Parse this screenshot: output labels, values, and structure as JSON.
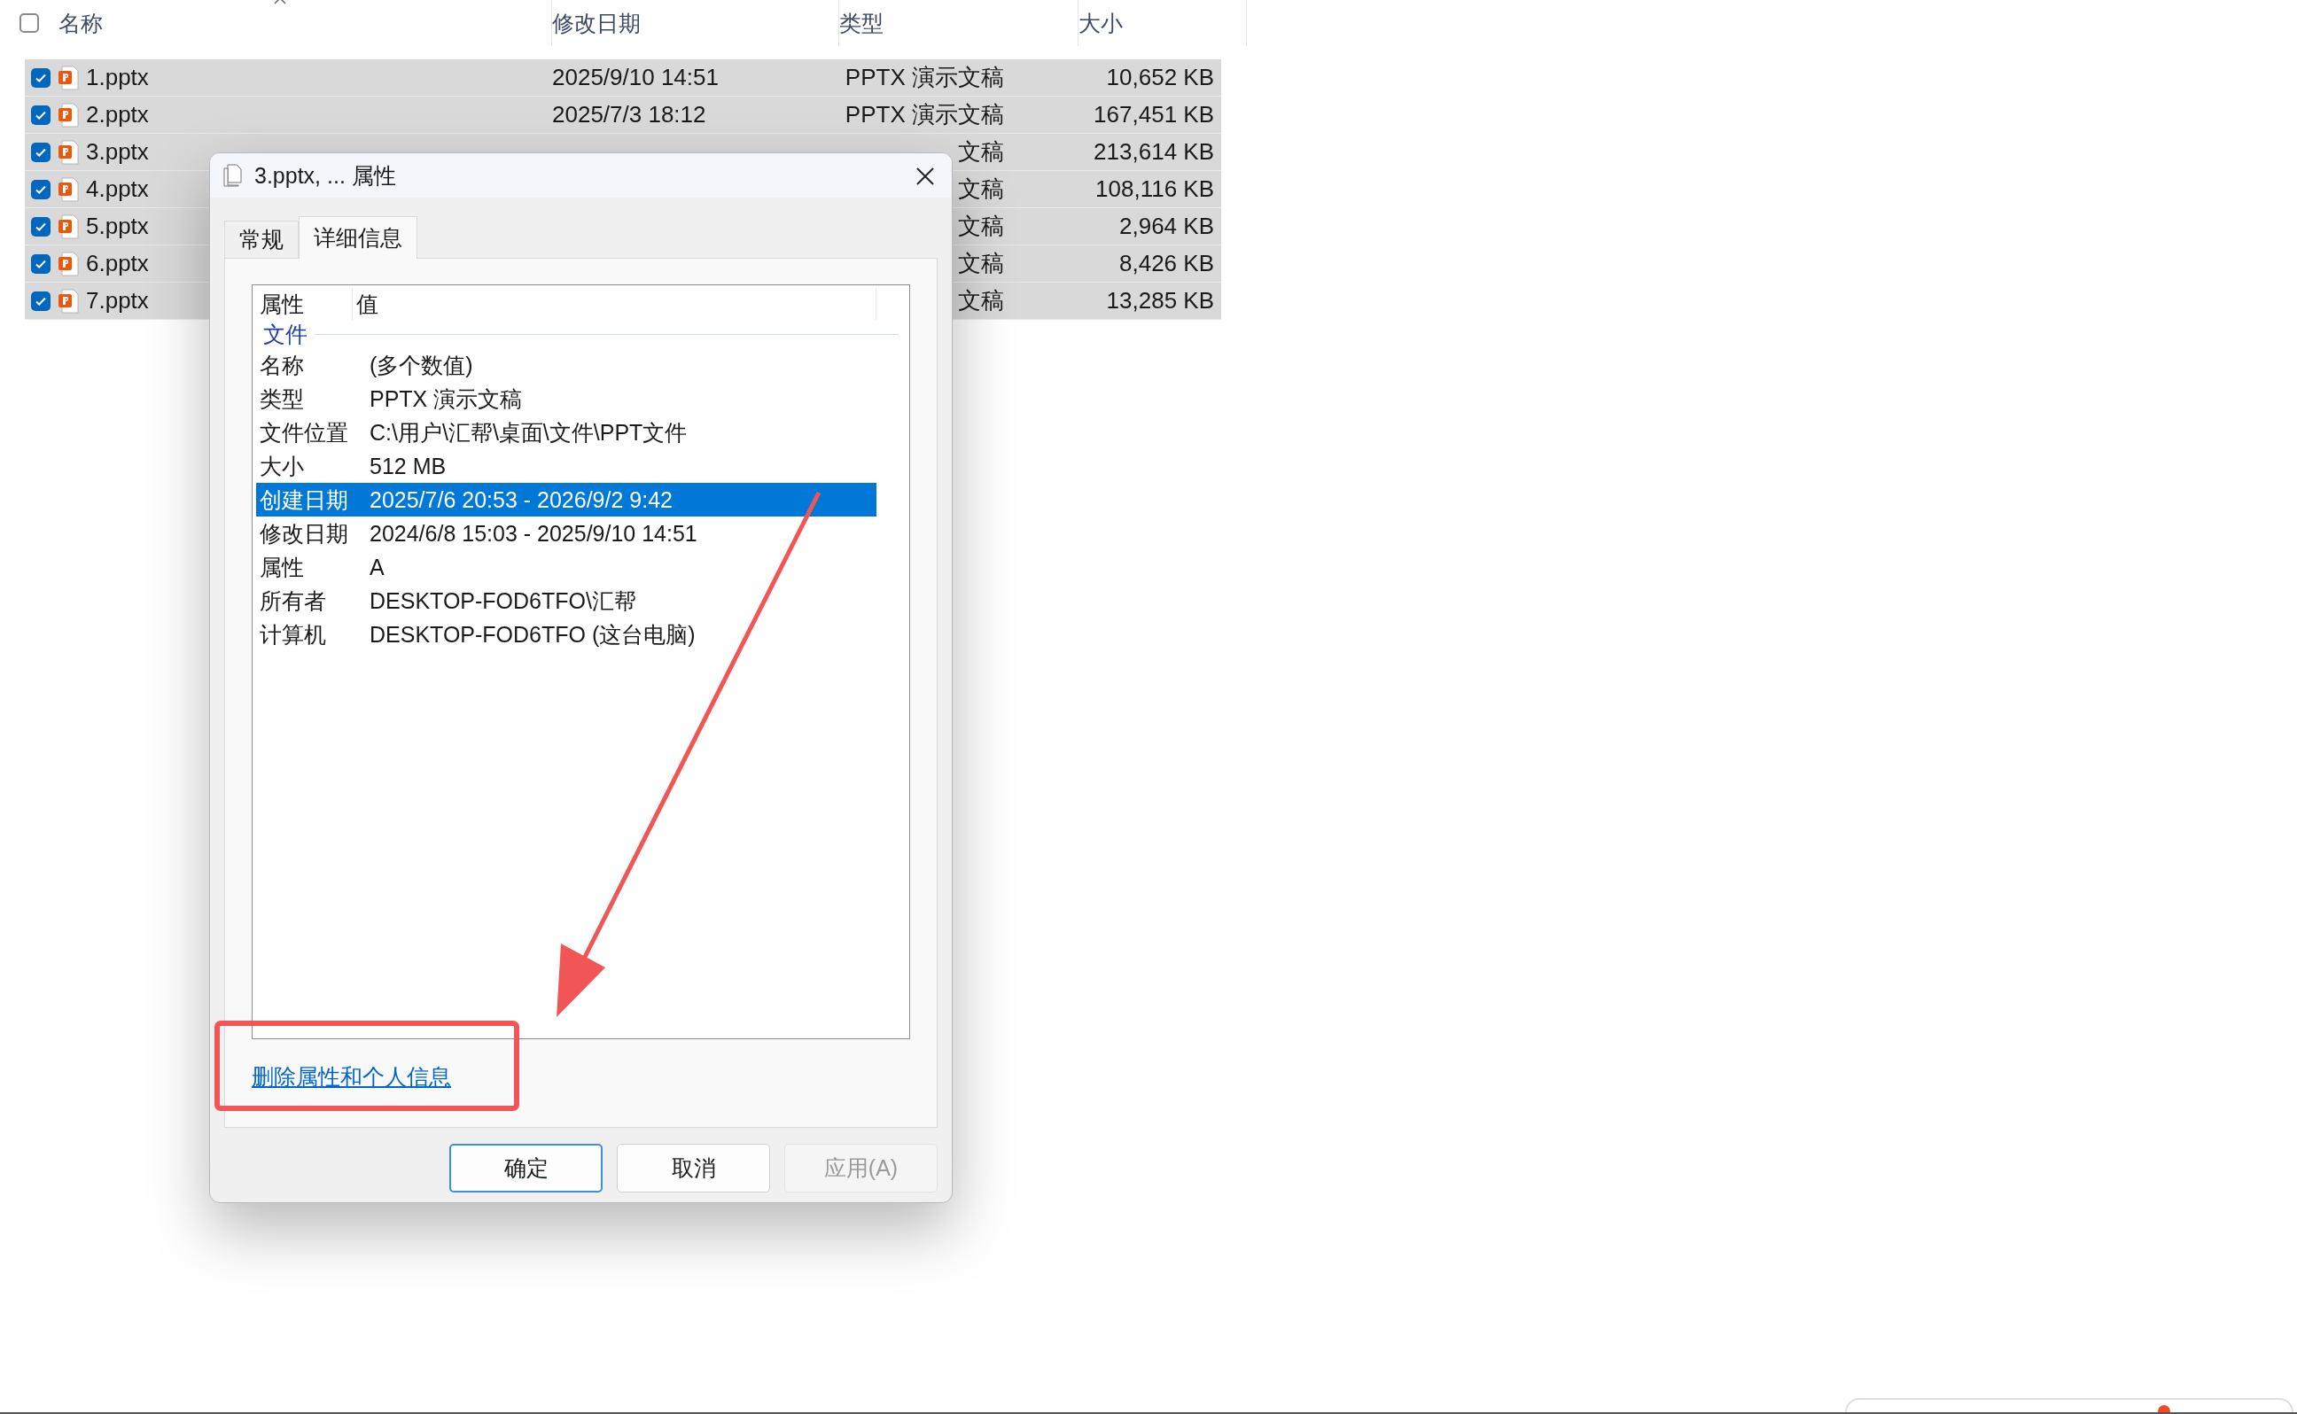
{
  "file_list": {
    "select_all": {
      "checked": false
    },
    "columns": [
      "名称",
      "修改日期",
      "类型",
      "大小"
    ],
    "rows": [
      {
        "name": "1.pptx",
        "modified": "2025/9/10 14:51",
        "type": "PPTX 演示文稿",
        "size": "10,652 KB",
        "checked": true,
        "selected": true
      },
      {
        "name": "2.pptx",
        "modified": "2025/7/3 18:12",
        "type": "PPTX 演示文稿",
        "size": "167,451 KB",
        "checked": true,
        "selected": true
      },
      {
        "name": "3.pptx",
        "type": "文稿",
        "size": "213,614 KB",
        "checked": true,
        "selected": true
      },
      {
        "name": "4.pptx",
        "type": "文稿",
        "size": "108,116 KB",
        "checked": true,
        "selected": true
      },
      {
        "name": "5.pptx",
        "type": "文稿",
        "size": "2,964 KB",
        "checked": true,
        "selected": true
      },
      {
        "name": "6.pptx",
        "type": "文稿",
        "size": "8,426 KB",
        "checked": true,
        "selected": true
      },
      {
        "name": "7.pptx",
        "type": "文稿",
        "size": "13,285 KB",
        "checked": true,
        "selected": true
      }
    ]
  },
  "dialog": {
    "title": "3.pptx, ... 属性",
    "tabs": [
      {
        "label": "常规",
        "selected": false
      },
      {
        "label": "详细信息",
        "selected": true
      }
    ],
    "details": {
      "columns": [
        "属性",
        "值"
      ],
      "group": "文件",
      "rows": [
        {
          "property": "名称",
          "value": "(多个数值)",
          "selected": false
        },
        {
          "property": "类型",
          "value": "PPTX 演示文稿",
          "selected": false
        },
        {
          "property": "文件位置",
          "value": "C:\\用户\\汇帮\\桌面\\文件\\PPT文件",
          "selected": false
        },
        {
          "property": "大小",
          "value": "512 MB",
          "selected": false
        },
        {
          "property": "创建日期",
          "value": "2025/7/6 20:53 - 2026/9/2 9:42",
          "selected": true
        },
        {
          "property": "修改日期",
          "value": "2024/6/8 15:03 - 2025/9/10 14:51",
          "selected": false
        },
        {
          "property": "属性",
          "value": "A",
          "selected": false
        },
        {
          "property": "所有者",
          "value": "DESKTOP-FOD6TFO\\汇帮",
          "selected": false
        },
        {
          "property": "计算机",
          "value": "DESKTOP-FOD6TFO (这台电脑)",
          "selected": false
        }
      ]
    },
    "link": "删除属性和个人信息",
    "buttons": [
      {
        "label": "确定",
        "kind": "default",
        "disabled": false
      },
      {
        "label": "取消",
        "kind": "normal",
        "disabled": false
      },
      {
        "label": "应用(A)",
        "kind": "normal",
        "disabled": true
      }
    ]
  }
}
